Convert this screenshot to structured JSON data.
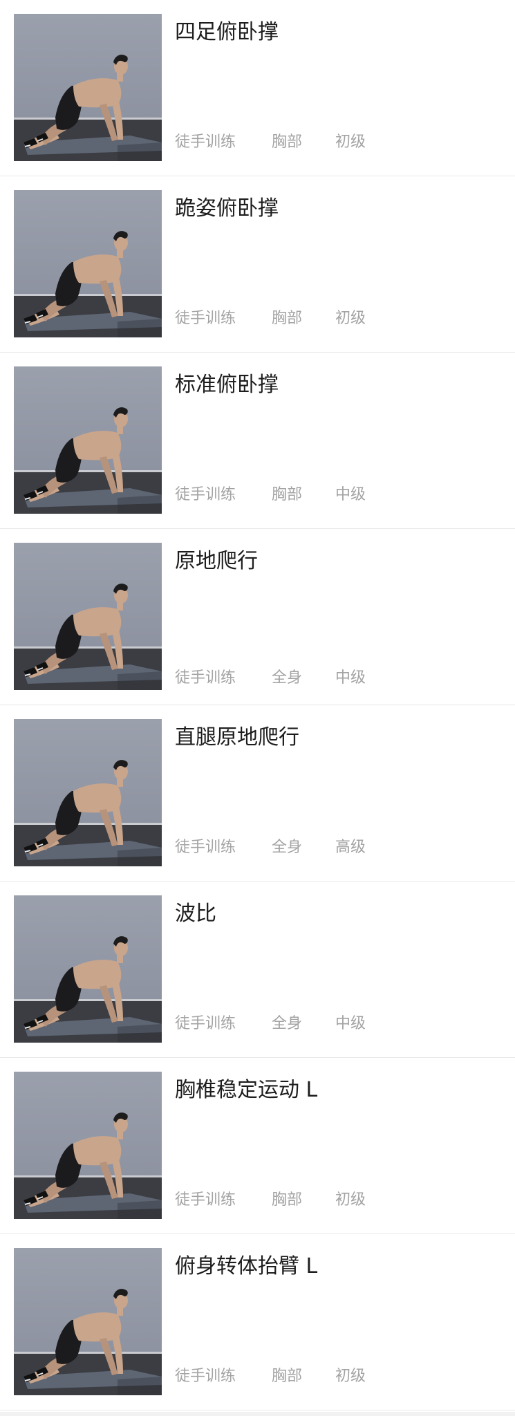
{
  "exercises": [
    {
      "title": "四足俯卧撑",
      "type": "徒手训练",
      "part": "胸部",
      "level": "初级"
    },
    {
      "title": "跪姿俯卧撑",
      "type": "徒手训练",
      "part": "胸部",
      "level": "初级"
    },
    {
      "title": "标准俯卧撑",
      "type": "徒手训练",
      "part": "胸部",
      "level": "中级"
    },
    {
      "title": "原地爬行",
      "type": "徒手训练",
      "part": "全身",
      "level": "中级"
    },
    {
      "title": "直腿原地爬行",
      "type": "徒手训练",
      "part": "全身",
      "level": "高级"
    },
    {
      "title": "波比",
      "type": "徒手训练",
      "part": "全身",
      "level": "中级"
    },
    {
      "title": "胸椎稳定运动 L",
      "type": "徒手训练",
      "part": "胸部",
      "level": "初级"
    },
    {
      "title": "俯身转体抬臂 L",
      "type": "徒手训练",
      "part": "胸部",
      "level": "初级"
    }
  ],
  "colors": {
    "title": "#1d1d1d",
    "meta": "#a3a3a3",
    "divider": "#e9e9e9",
    "wall": "#8e93a1",
    "floor": "#3b3d42",
    "mat": "#5e6674",
    "skin": "#c9a58c",
    "shorts": "#1b1b1e"
  }
}
